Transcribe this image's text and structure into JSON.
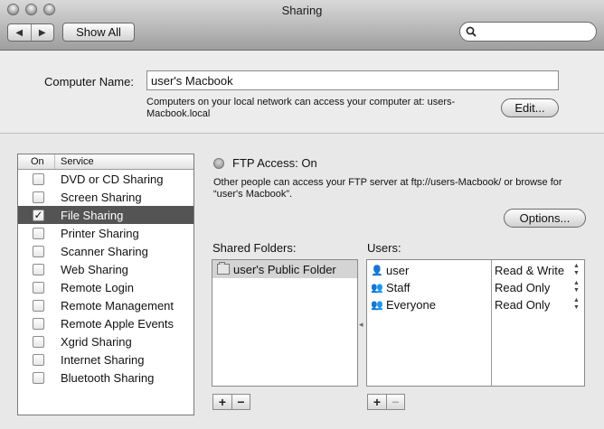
{
  "window": {
    "title": "Sharing"
  },
  "toolbar": {
    "back_glyph": "◀",
    "forward_glyph": "▶",
    "show_all_label": "Show All",
    "search_placeholder": "",
    "search_icon": "magnifier-icon"
  },
  "computer_name": {
    "label": "Computer Name:",
    "value": "user's Macbook",
    "note": "Computers on your local network can access your computer at: users-Macbook.local",
    "edit_label": "Edit..."
  },
  "services": {
    "header_on": "On",
    "header_service": "Service",
    "items": [
      {
        "label": "DVD or CD Sharing",
        "checked": false,
        "selected": false
      },
      {
        "label": "Screen Sharing",
        "checked": false,
        "selected": false
      },
      {
        "label": "File Sharing",
        "checked": true,
        "selected": true
      },
      {
        "label": "Printer Sharing",
        "checked": false,
        "selected": false
      },
      {
        "label": "Scanner Sharing",
        "checked": false,
        "selected": false
      },
      {
        "label": "Web Sharing",
        "checked": false,
        "selected": false
      },
      {
        "label": "Remote Login",
        "checked": false,
        "selected": false
      },
      {
        "label": "Remote Management",
        "checked": false,
        "selected": false
      },
      {
        "label": "Remote Apple Events",
        "checked": false,
        "selected": false
      },
      {
        "label": "Xgrid Sharing",
        "checked": false,
        "selected": false
      },
      {
        "label": "Internet Sharing",
        "checked": false,
        "selected": false
      },
      {
        "label": "Bluetooth Sharing",
        "checked": false,
        "selected": false
      }
    ]
  },
  "detail": {
    "status": "FTP Access: On",
    "description": "Other people can access your FTP server at ftp://users-Macbook/ or browse for “user's Macbook”.",
    "options_label": "Options...",
    "shared_folders_label": "Shared Folders:",
    "users_label": "Users:",
    "folders": [
      {
        "name": "user's Public Folder",
        "icon": "folder-icon"
      }
    ],
    "users": [
      {
        "name": "user",
        "permission": "Read & Write",
        "icon": "single-person-icon"
      },
      {
        "name": "Staff",
        "permission": "Read Only",
        "icon": "group-icon"
      },
      {
        "name": "Everyone",
        "permission": "Read Only",
        "icon": "group-icon"
      }
    ],
    "add_label": "+",
    "remove_label": "−"
  }
}
